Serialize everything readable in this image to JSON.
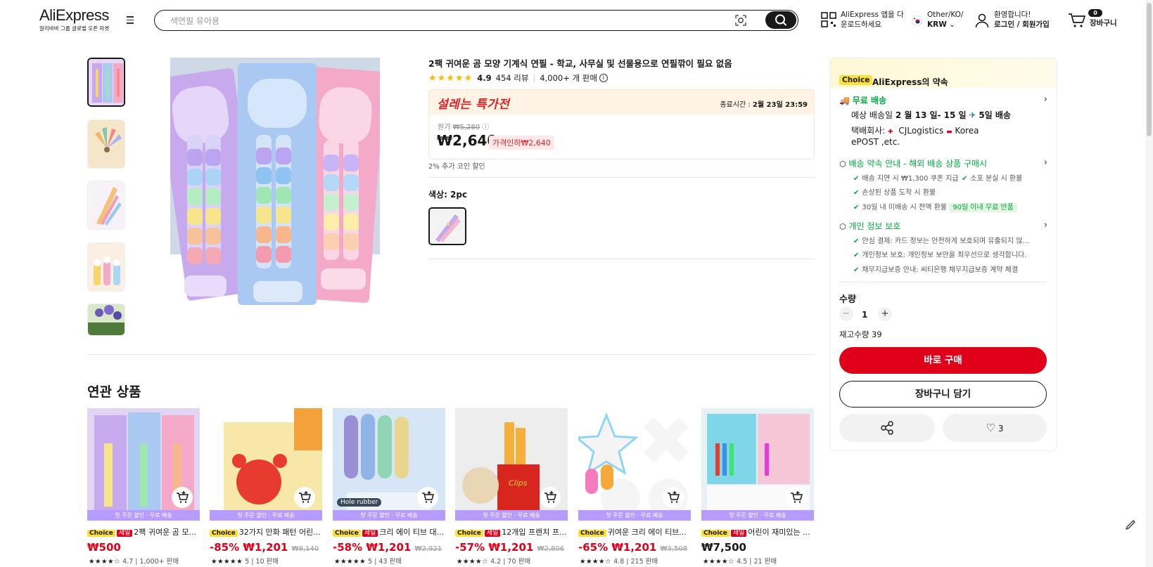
{
  "header": {
    "logo": "AliExpress",
    "logo_sub": "알리바바 그룹 글로벌 오픈 마켓",
    "search_placeholder": "색연필 유아용",
    "app_line1": "AliExpress 앱을 다",
    "app_line2": "운로드하세요",
    "region_line1": "Other/KO/",
    "region_line2": "KRW",
    "user_line1": "환영합니다!",
    "user_line2": "로그인 / 회원가입",
    "cart_count": "0",
    "cart_label": "장바구니"
  },
  "product": {
    "title": "2팩 귀여운 곰 모양 기계식 연필 - 학교, 사무실 및 선물용으로 연필깎이 필요 없음",
    "rating": "4.9",
    "reviews": "454 리뷰",
    "sold": "4,000+ 개 판매",
    "deal_brand": "설레는 특가전",
    "deal_end_label": "종료시간 :",
    "deal_end_value": "2월 23일 23:59",
    "orig_label": "원가",
    "orig_price": "₩5,280",
    "price": "₩2,640",
    "discount": "가격인하₩2,640",
    "coin_note": "2% 추가 코인 할인",
    "color_label": "색상: 2pc"
  },
  "panel": {
    "choice": "Choice",
    "promise": "AliExpress의 약속",
    "free_shipping": "무료 배송",
    "delivery_pre": "예상 배송일",
    "delivery_dates": "2 월 13 일- 15 일",
    "delivery_days": "5일 배송",
    "courier_label": "택배회사:",
    "courier1": "CJLogistics",
    "courier2": "Korea",
    "courier3": "ePOST ,etc.",
    "guarantee_title": "배송 약속 안내 - 해외 배송 상품 구매시",
    "g1": "배송 지연 시 ₩1,300 쿠폰 지급",
    "g2": "소포 분실 시 환불",
    "g3": "손상된 상품 도착 시 환불",
    "g4": "30일 내 미배송 시 전액 환불",
    "g4_pill": "90일 이내 무료 반품",
    "privacy_title": "개인 정보 보호",
    "p1": "안심 결제: 카드 정보는 안전하게 보호되며 유출되지 않...",
    "p2": "개인정보 보호: 개인정보 보안을 최우선으로 생각합니다.",
    "p3": "채무지급보증 안내: 씨티은행 채무지급보증 계약 체결",
    "qty_label": "수량",
    "qty_value": "1",
    "qty_minus": "−",
    "qty_plus": "+",
    "stock": "재고수량 39",
    "buy_now": "바로 구매",
    "add_cart": "장바구니 담기",
    "wish_count": "3"
  },
  "related": {
    "title": "연관 상품",
    "strip": "첫 주문 할인 · 무료 배송",
    "items": [
      {
        "choice": "Choice",
        "sale": "세일",
        "name": "2팩 귀여운 곰 모...",
        "price": "₩500",
        "discount": "",
        "orig": "",
        "stars": "★★★★☆",
        "rating": "4.7",
        "sold": "1,000+ 판매"
      },
      {
        "choice": "Choice",
        "sale": "",
        "name": "32가지 만화 패턴 어린...",
        "price": "₩1,201",
        "discount": "-85%",
        "orig": "₩8,140",
        "stars": "★★★★★",
        "rating": "5",
        "sold": "10 판매"
      },
      {
        "choice": "Choice",
        "sale": "세일",
        "name": "크리 에이 티브 대...",
        "price": "₩1,201",
        "discount": "-58%",
        "orig": "₩2,921",
        "stars": "★★★★★",
        "rating": "5",
        "sold": "43 판매"
      },
      {
        "choice": "Choice",
        "sale": "세일",
        "name": "12개입 프렌치 프...",
        "price": "₩1,201",
        "discount": "-57%",
        "orig": "₩2,806",
        "stars": "★★★★☆",
        "rating": "4.2",
        "sold": "70 판매"
      },
      {
        "choice": "Choice",
        "sale": "",
        "name": "귀여운 크리 에이 티브...",
        "price": "₩1,201",
        "discount": "-65%",
        "orig": "₩3,508",
        "stars": "★★★★☆",
        "rating": "4.8",
        "sold": "215 판매"
      },
      {
        "choice": "Choice",
        "sale": "세일",
        "name": "어린이 재미있는 ...",
        "price": "₩7,500",
        "discount": "",
        "orig": "",
        "stars": "★★★★☆",
        "rating": "4.5",
        "sold": "21 판매"
      }
    ],
    "img_text_hole": "Hole rubber",
    "img_text_clips": "Clips"
  }
}
